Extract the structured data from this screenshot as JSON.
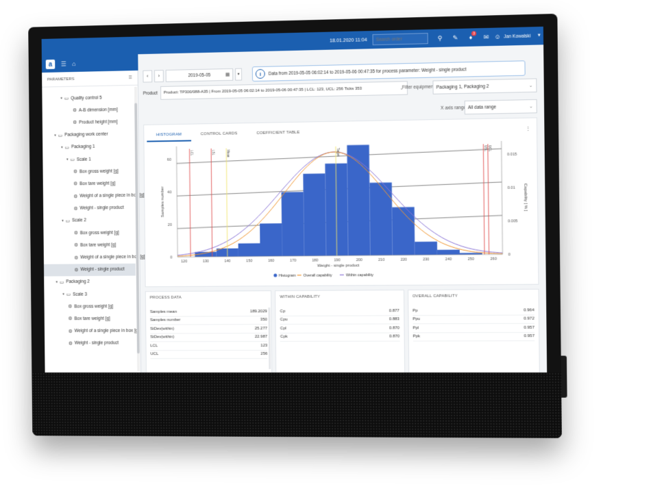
{
  "topbar": {
    "datetime": "18.01.2020 11:04",
    "search_placeholder": "Search order",
    "notification_count": "3",
    "user_name": "Jan Kowalski"
  },
  "sidebar": {
    "header": "PARAMETERS",
    "items": [
      {
        "level": 2,
        "type": "folder",
        "label": "Quality control 5"
      },
      {
        "level": 4,
        "type": "param",
        "label": "A-B dimension [mm]"
      },
      {
        "level": 4,
        "type": "param",
        "label": "Product height [mm]"
      },
      {
        "level": 1,
        "type": "folder",
        "label": "Packaging work center"
      },
      {
        "level": 2,
        "type": "folder",
        "label": "Packaging 1"
      },
      {
        "level": 3,
        "type": "folder",
        "label": "Scale 1"
      },
      {
        "level": 4,
        "type": "param",
        "label": "Box gross weight [g]"
      },
      {
        "level": 4,
        "type": "param",
        "label": "Box tare weight [g]"
      },
      {
        "level": 4,
        "type": "param",
        "label": "Weight of a single piece in box [g]"
      },
      {
        "level": 4,
        "type": "param",
        "label": "Weight - single product"
      },
      {
        "level": 2,
        "type": "folder",
        "label": "Scale 2"
      },
      {
        "level": 4,
        "type": "param",
        "label": "Box gross weight [g]"
      },
      {
        "level": 4,
        "type": "param",
        "label": "Box tare weight [g]"
      },
      {
        "level": 4,
        "type": "param",
        "label": "Weight of a single piece in box [g]"
      },
      {
        "level": 4,
        "type": "param",
        "label": "Weight - single product",
        "selected": true
      },
      {
        "level": 1,
        "type": "folder",
        "label": "Packaging 2"
      },
      {
        "level": 2,
        "type": "folder",
        "label": "Scale 3"
      },
      {
        "level": 3,
        "type": "param",
        "label": "Box gross weight [g]"
      },
      {
        "level": 3,
        "type": "param",
        "label": "Box tare weight [g]"
      },
      {
        "level": 3,
        "type": "param",
        "label": "Weight of a single piece in box [g]"
      },
      {
        "level": 3,
        "type": "param",
        "label": "Weight - single product"
      }
    ]
  },
  "controls": {
    "date": "2019-05-05",
    "info_text": "Data from 2019-05-05 06:02:14 to 2019-05-06 00:47:35 for process parameter: Weight - single product",
    "product_label": "Product",
    "product_value": "Product: TP300/088-A35 | From 2019-05-05 06:02:14 to 2019-05-06 00:47:35 | LCL: 123, UCL: 256 Ticks 353",
    "filter_label": "Filter equipments",
    "filter_value": "Packaging 1, Packaging 2",
    "xaxis_label": "X axis range",
    "xaxis_value": "All data range"
  },
  "tabs": [
    "HISTOGRAM",
    "CONTROL CARDS",
    "COEFFICIENT TABLE"
  ],
  "chart_data": {
    "type": "bar",
    "x": [
      130,
      140,
      150,
      160,
      170,
      180,
      190,
      200,
      210,
      220,
      230,
      240,
      250
    ],
    "values": [
      3,
      5,
      8,
      20,
      39,
      50,
      56,
      67,
      44,
      29,
      8,
      3,
      1
    ],
    "xlabel": "Weight - single product",
    "ylabel": "Samples number",
    "y2label": "Capability [ % ]",
    "xticks": [
      120,
      130,
      140,
      150,
      160,
      170,
      180,
      190,
      200,
      210,
      220,
      230,
      240,
      250,
      260
    ],
    "yticks": [
      0,
      20,
      40,
      60
    ],
    "y2ticks": [
      "0",
      "0.005",
      "0.01",
      "0.015"
    ],
    "ylim": [
      0,
      68
    ],
    "xlim": [
      117,
      264
    ],
    "vlines": [
      {
        "label": "LCL",
        "x": 123,
        "color": "#e05050"
      },
      {
        "label": "LSL",
        "x": 133,
        "color": "#e05050"
      },
      {
        "label": "Mean",
        "x": 140,
        "color": "#f2e46b"
      },
      {
        "label": "Target",
        "x": 189.9,
        "color": "#f2e46b"
      },
      {
        "label": "USL",
        "x": 256,
        "color": "#e05050"
      },
      {
        "label": "UCL",
        "x": 258,
        "color": "#e05050"
      }
    ],
    "legend": [
      "Histogram",
      "Overall capability",
      "Within capability"
    ],
    "legend_colors": [
      "#3a66c9",
      "#f0952e",
      "#8a74d6"
    ]
  },
  "process_data": {
    "title": "PROCESS DATA",
    "rows": [
      {
        "k": "Samples mean",
        "v": "189.2029"
      },
      {
        "k": "Samples number",
        "v": "350"
      },
      {
        "k": "StDev(within)",
        "v": "25.277"
      },
      {
        "k": "StDev(within)",
        "v": "22.987"
      },
      {
        "k": "LCL",
        "v": "123"
      },
      {
        "k": "UCL",
        "v": "256"
      }
    ]
  },
  "within_capability": {
    "title": "WITHIN CAPABILITY",
    "rows": [
      {
        "k": "Cp",
        "v": "0.877"
      },
      {
        "k": "Cpu",
        "v": "0.883"
      },
      {
        "k": "Cpl",
        "v": "0.870"
      },
      {
        "k": "Cpk",
        "v": "0.870"
      }
    ]
  },
  "overall_capability": {
    "title": "OVERALL CAPABILITY",
    "rows": [
      {
        "k": "Pp",
        "v": "0.964"
      },
      {
        "k": "Ppu",
        "v": "0.972"
      },
      {
        "k": "Ppl",
        "v": "0.957"
      },
      {
        "k": "Ppk",
        "v": "0.957"
      }
    ]
  }
}
